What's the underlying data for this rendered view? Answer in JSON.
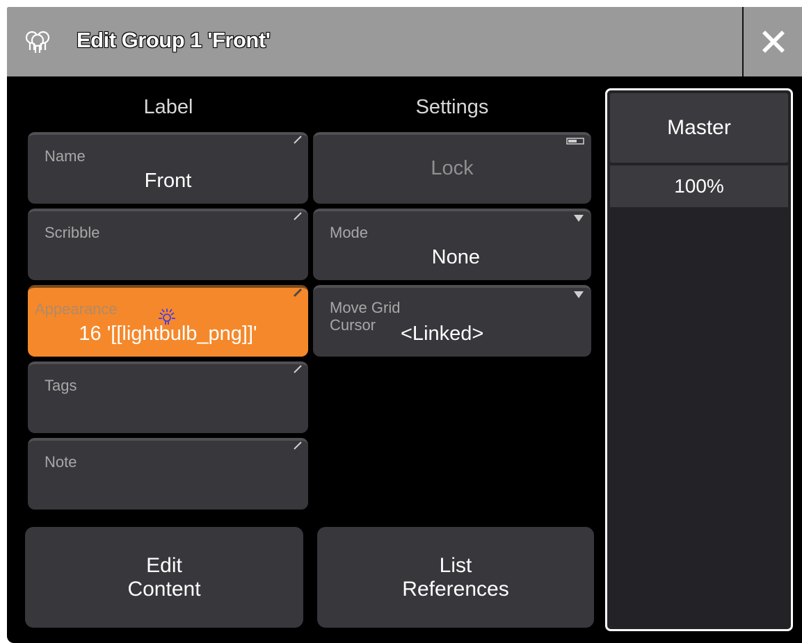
{
  "window": {
    "title": "Edit Group 1 'Front'",
    "title_icon": "lightbulbs-icon",
    "close_icon": "close-icon"
  },
  "columns": {
    "label_header": "Label",
    "settings_header": "Settings"
  },
  "label_fields": {
    "name": {
      "label": "Name",
      "value": "Front"
    },
    "scribble": {
      "label": "Scribble",
      "value": ""
    },
    "appearance": {
      "label": "Appearance",
      "value": "16 '[[lightbulb_png]]'"
    },
    "tags": {
      "label": "Tags",
      "value": ""
    },
    "note": {
      "label": "Note",
      "value": ""
    }
  },
  "settings_fields": {
    "lock": {
      "value": "Lock"
    },
    "mode": {
      "label": "Mode",
      "value": "None"
    },
    "move_grid_cursor": {
      "label_line1": "Move Grid",
      "label_line2": "Cursor",
      "value": "<Linked>"
    }
  },
  "buttons": {
    "edit_content_line1": "Edit",
    "edit_content_line2": "Content",
    "list_references_line1": "List",
    "list_references_line2": "References"
  },
  "master": {
    "header": "Master",
    "value": "100%"
  },
  "colors": {
    "accent_orange": "#f5882a",
    "field_bg": "#37373c",
    "titlebar_bg": "#9a9a9a",
    "background": "#000000"
  }
}
